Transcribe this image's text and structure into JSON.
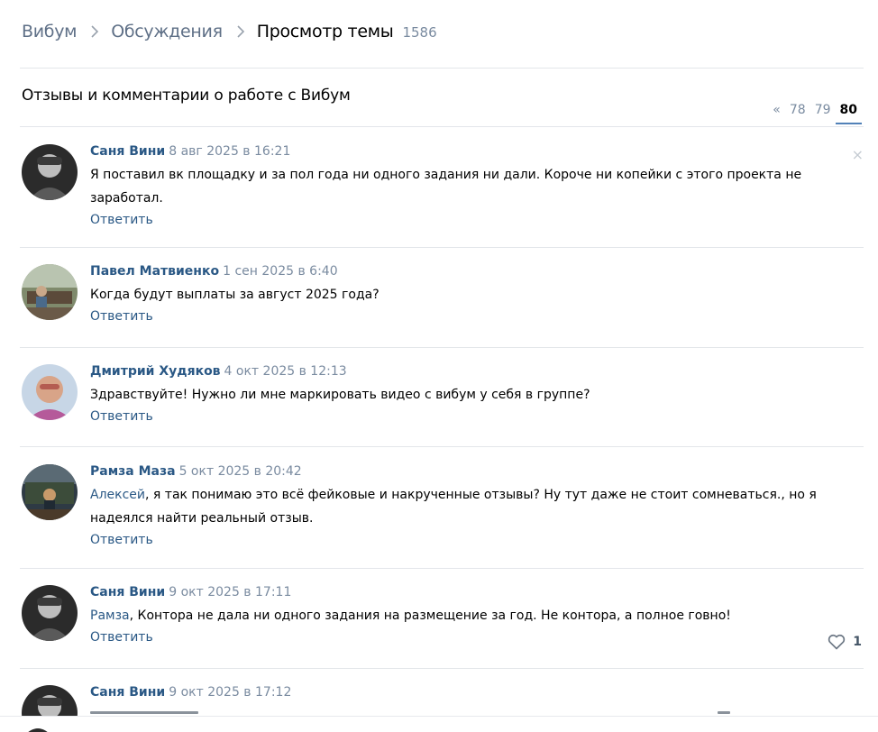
{
  "breadcrumb": {
    "home": "Вибум",
    "discussions": "Обсуждения",
    "current": "Просмотр темы",
    "count": "1586"
  },
  "topic": {
    "title": "Отзывы и комментарии о работе с Вибум"
  },
  "pagination": {
    "prev": "«",
    "pages": [
      "78",
      "79",
      "80"
    ],
    "active": "80"
  },
  "dismiss_glyph": "×",
  "posts": [
    {
      "author": "Саня Вини",
      "date": "8 авг 2025 в 16:21",
      "text_lines": [
        "Я поставил вк площадку и за пол года ни одного задания ни дали. Короче ни копейки с этого проекта не",
        "заработал."
      ],
      "reply": "Ответить"
    },
    {
      "author": "Павел Матвиенко",
      "date": "1 сен 2025 в 6:40",
      "text_lines": [
        "Когда будут выплаты за август 2025 года?"
      ],
      "reply": "Ответить"
    },
    {
      "author": "Дмитрий Худяков",
      "date": "4 окт 2025 в 12:13",
      "text_lines": [
        "Здравствуйте! Нужно ли мне маркировать видео с вибум у себя в группе?"
      ],
      "reply": "Ответить"
    },
    {
      "author": "Рамза Маза",
      "date": "5 окт 2025 в 20:42",
      "mention": "Алексей",
      "text_lines": [
        ", я так понимаю это всё фейковые и накрученные отзывы? Ну тут даже не стоит сомневаться., но я",
        "надеялся найти реальный отзыв."
      ],
      "reply": "Ответить"
    },
    {
      "author": "Саня Вини",
      "date": "9 окт 2025 в 17:11",
      "mention": "Рамза",
      "text_lines": [
        ", Контора не дала ни одного задания на размещение за год. Не контора, а полное говно!"
      ],
      "reply": "Ответить",
      "likes": "1"
    },
    {
      "author": "Саня Вини",
      "date": "9 окт 2025 в 17:12"
    }
  ]
}
